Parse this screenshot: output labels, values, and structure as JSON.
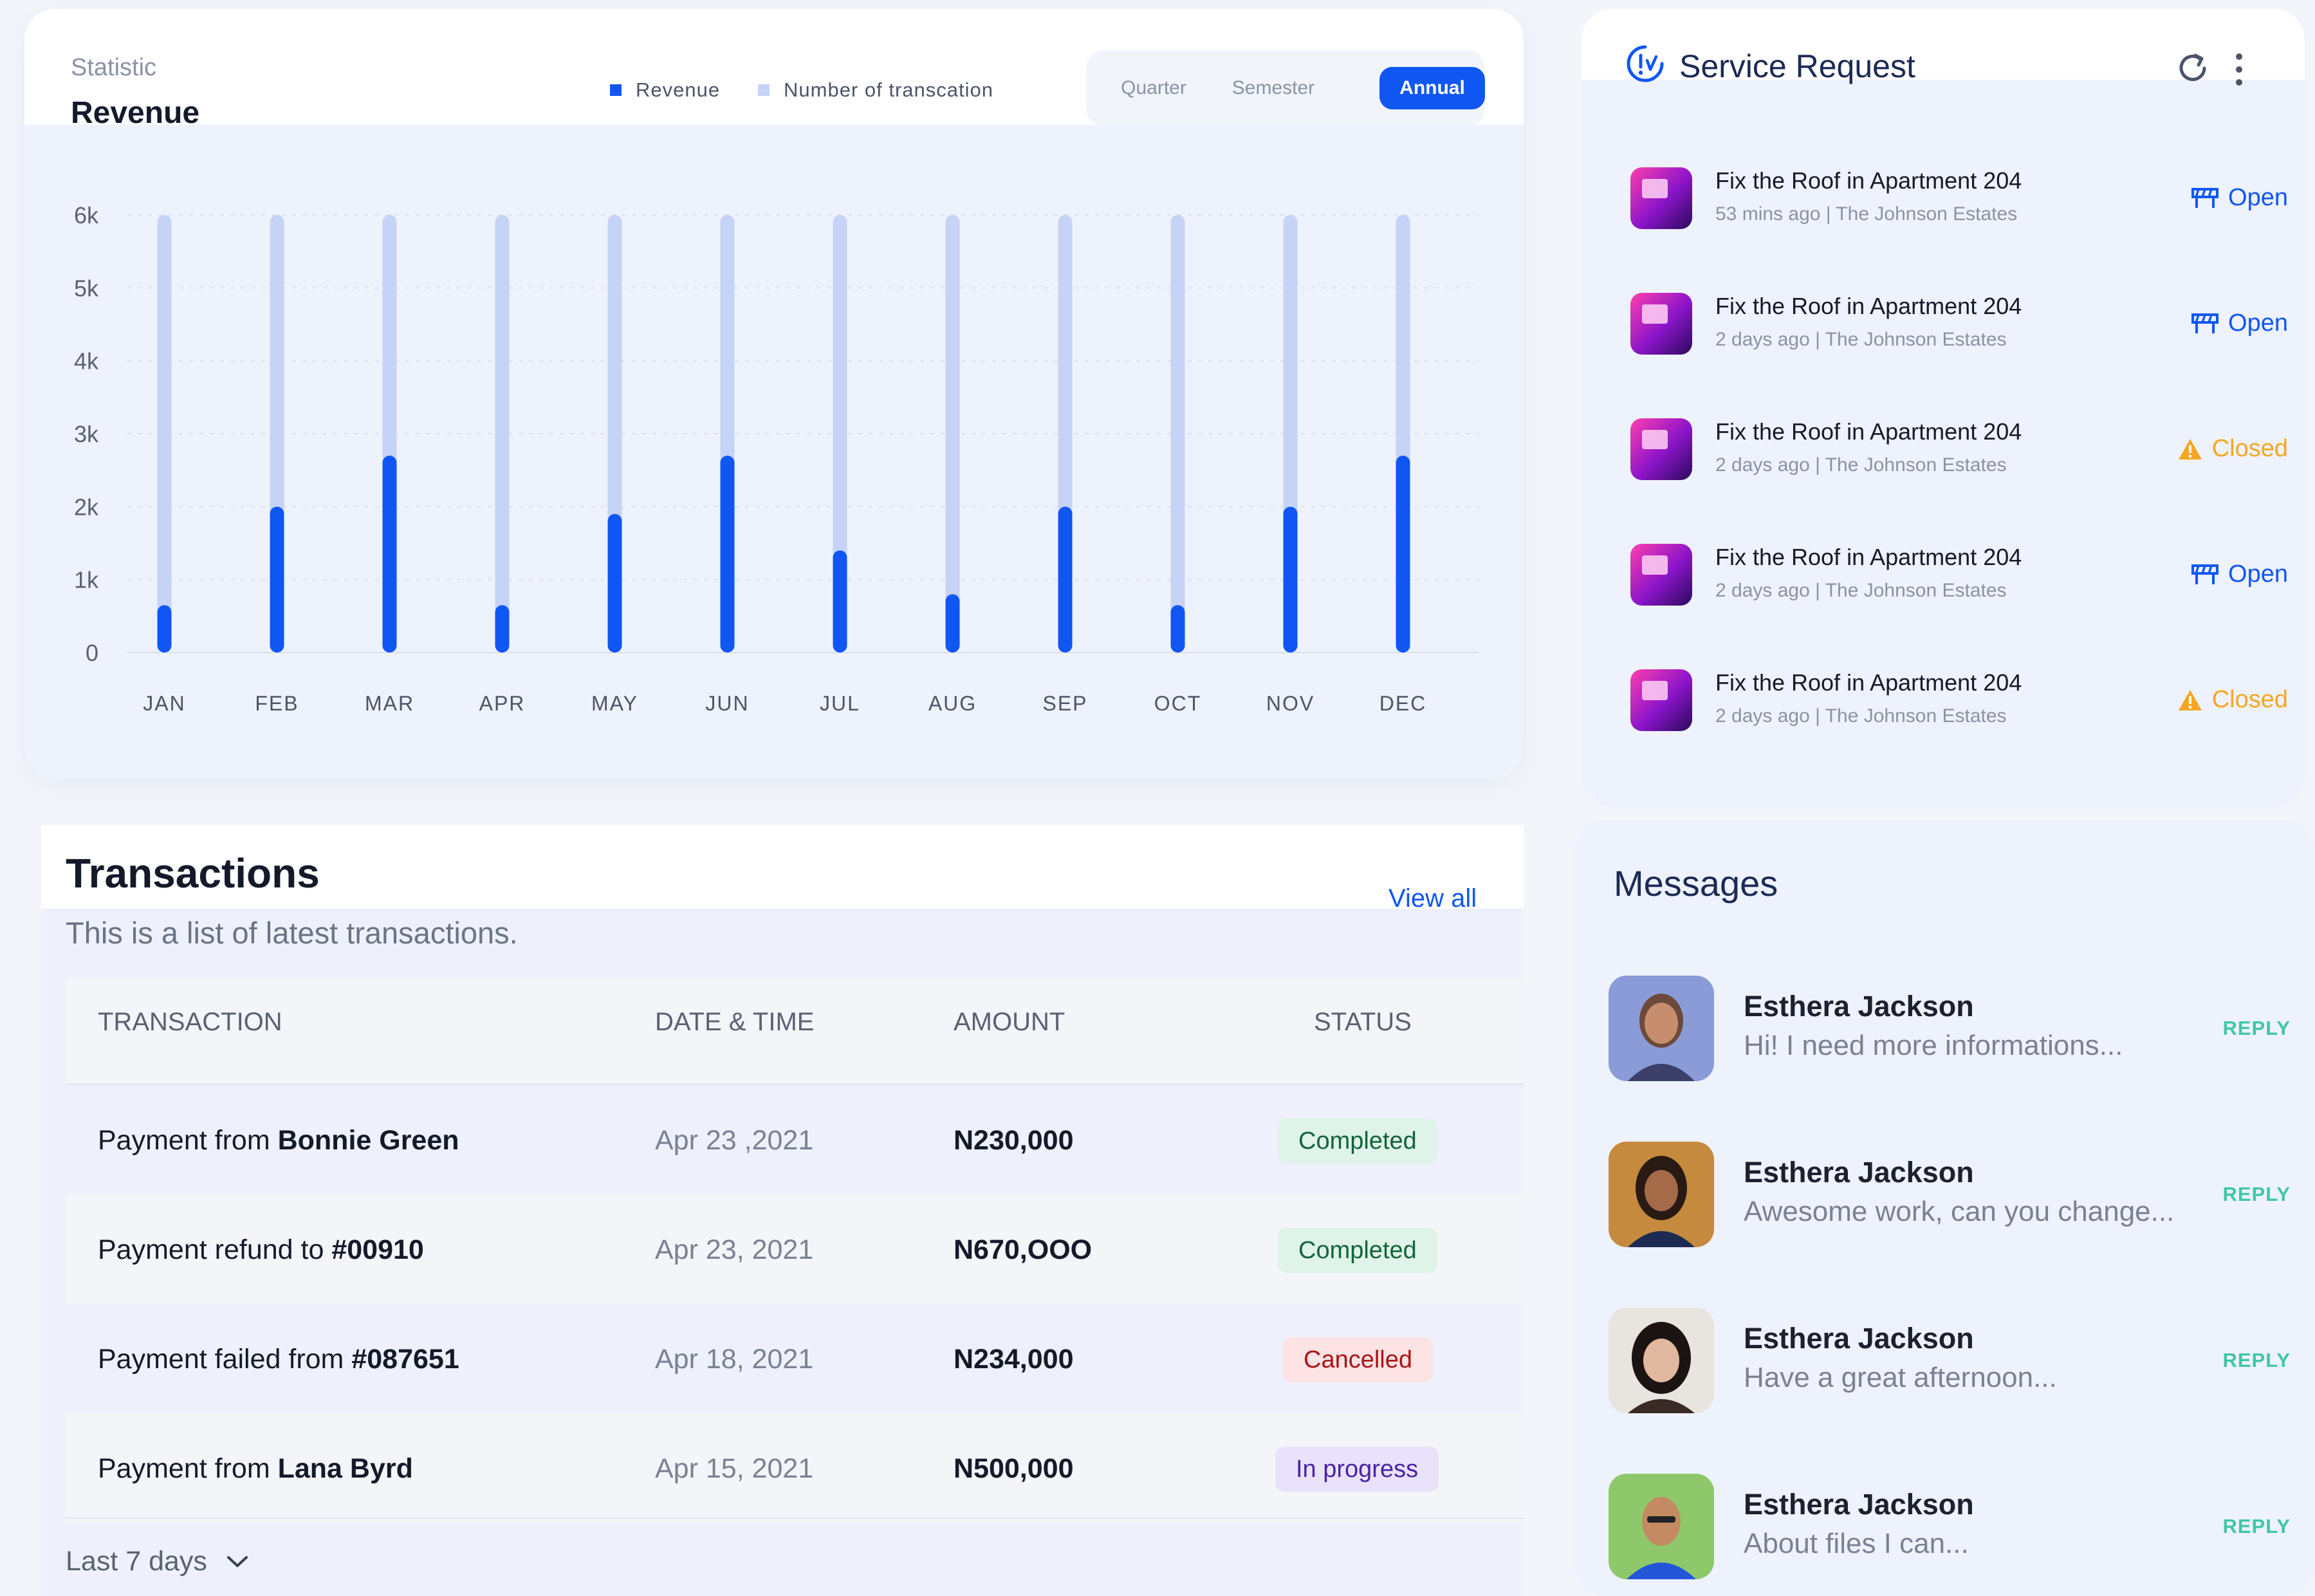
{
  "statistic": {
    "label": "Statistic",
    "title": "Revenue",
    "legend": [
      {
        "label": "Revenue",
        "color": "#0f56f3"
      },
      {
        "label": "Number of transcation",
        "color": "#c5d3f7"
      }
    ],
    "periods": [
      "Quarter",
      "Semester",
      "Annual"
    ],
    "active_period": "Annual"
  },
  "chart_data": {
    "type": "bar",
    "categories": [
      "JAN",
      "FEB",
      "MAR",
      "APR",
      "MAY",
      "JUN",
      "JUL",
      "AUG",
      "SEP",
      "OCT",
      "NOV",
      "DEC"
    ],
    "y_ticks": [
      "0",
      "1k",
      "2k",
      "3k",
      "4k",
      "5k",
      "6k"
    ],
    "ylim": [
      0,
      6000
    ],
    "grid": true,
    "series": [
      {
        "name": "Revenue",
        "color": "#0f56f3",
        "values": [
          650,
          2000,
          2700,
          650,
          1900,
          2700,
          1400,
          800,
          2000,
          650,
          2000,
          2700
        ]
      },
      {
        "name": "Number of transcation",
        "color": "#c5d3f7",
        "values": [
          6000,
          6000,
          6000,
          6000,
          6000,
          6000,
          6000,
          6000,
          6000,
          6000,
          6000,
          6000
        ]
      }
    ]
  },
  "transactions": {
    "title": "Transactions",
    "subtitle": "This is a list of latest transactions.",
    "view_all": "View all",
    "headers": [
      "TRANSACTION",
      "DATE & TIME",
      "AMOUNT",
      "STATUS"
    ],
    "rows": [
      {
        "desc_prefix": "Payment from ",
        "desc_bold": "Bonnie Green",
        "date": "Apr 23 ,2021",
        "amount": "N230,000",
        "status": "Completed"
      },
      {
        "desc_prefix": "Payment refund to ",
        "desc_bold": "#00910",
        "date": "Apr 23, 2021",
        "amount": "N670,OOO",
        "status": "Completed"
      },
      {
        "desc_prefix": "Payment failed from ",
        "desc_bold": "#087651",
        "date": "Apr 18, 2021",
        "amount": "N234,000",
        "status": "Cancelled"
      },
      {
        "desc_prefix": "Payment from ",
        "desc_bold": "Lana Byrd",
        "date": "Apr 15, 2021",
        "amount": "N500,000",
        "status": "In progress"
      }
    ],
    "footer_range": "Last 7 days"
  },
  "service_request": {
    "title": "Service Request",
    "items": [
      {
        "title": "Fix the Roof in Apartment 204",
        "time": "53 mins ago",
        "place": "The Johnson Estates",
        "status": "Open"
      },
      {
        "title": "Fix the Roof in Apartment 204",
        "time": "2 days ago",
        "place": "The Johnson Estates",
        "status": "Open"
      },
      {
        "title": "Fix the Roof in Apartment 204",
        "time": "2 days ago",
        "place": "The Johnson Estates",
        "status": "Closed"
      },
      {
        "title": "Fix the Roof in Apartment 204",
        "time": "2 days ago",
        "place": "The Johnson Estates",
        "status": "Open"
      },
      {
        "title": "Fix the Roof in Apartment 204",
        "time": "2 days ago",
        "place": "The Johnson Estates",
        "status": "Closed"
      }
    ]
  },
  "messages": {
    "title": "Messages",
    "reply_label": "REPLY",
    "items": [
      {
        "name": "Esthera Jackson",
        "text": "Hi! I need more informations..."
      },
      {
        "name": "Esthera Jackson",
        "text": "Awesome work, can you change..."
      },
      {
        "name": "Esthera Jackson",
        "text": "Have a great afternoon..."
      },
      {
        "name": "Esthera Jackson",
        "text": "About files I can..."
      }
    ]
  }
}
